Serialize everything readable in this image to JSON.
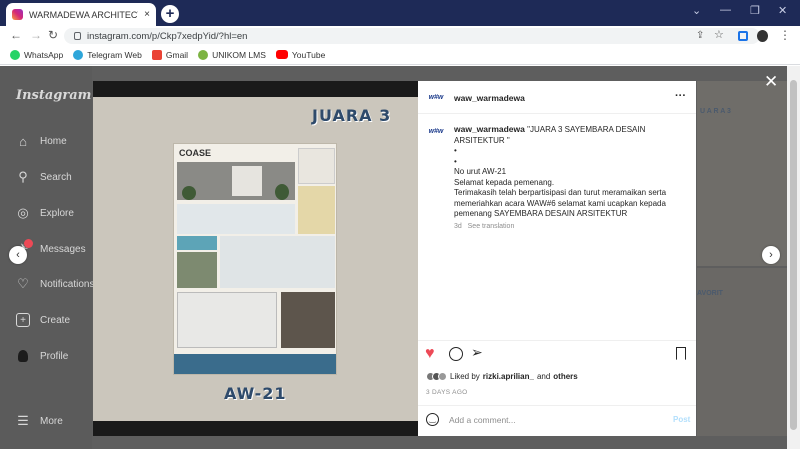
{
  "tab": {
    "title": "WARMADEWA ARCHITECTURE (@",
    "close": "×",
    "newtab": "+"
  },
  "window": {
    "min": "—",
    "restore": "❐",
    "close": "✕",
    "chevron": "⌄"
  },
  "address": {
    "url": "instagram.com/p/Ckp7xedpYid/?hl=en"
  },
  "bookmarks": [
    {
      "label": "WhatsApp",
      "color": "#25d366"
    },
    {
      "label": "Telegram Web",
      "color": "#2ea6da"
    },
    {
      "label": "Gmail",
      "color": "#ea4335"
    },
    {
      "label": "UNIKOM LMS",
      "color": "#7cb342"
    },
    {
      "label": "YouTube",
      "color": "#ff0000"
    }
  ],
  "sidebar": {
    "logo": "Instagram",
    "items": [
      {
        "label": "Home",
        "icon": "home-icon"
      },
      {
        "label": "Search",
        "icon": "search-icon"
      },
      {
        "label": "Explore",
        "icon": "explore-icon"
      },
      {
        "label": "Messages",
        "icon": "messages-icon"
      },
      {
        "label": "Notifications",
        "icon": "heart-icon"
      },
      {
        "label": "Create",
        "icon": "plus-icon"
      },
      {
        "label": "Profile",
        "icon": "profile-icon"
      }
    ],
    "more": "More"
  },
  "post": {
    "banner_top": "JUARA 3",
    "banner_bottom": "AW-21",
    "poster_title": "COASE",
    "username": "waw_warmadewa",
    "avatar_text": "w#w",
    "more": "···",
    "caption_lead": "\"JUARA 3 SAYEMBARA DESAIN ARSITEKTUR \"",
    "caption_lines": [
      "•",
      "•",
      "No urut AW-21",
      "Selamat kepada pemenang.",
      "Terimakasih telah berpartisipasi dan turut meramaikan serta memeriahkan acara WAW#6 selamat kami ucapkan kepada pemenang SAYEMBARA DESAIN ARSITEKTUR"
    ],
    "age": "3d",
    "see_translation": "See translation",
    "liked_by_prefix": "Liked by",
    "liked_user": "rizki.aprilian_",
    "liked_and": "and",
    "liked_others": "others",
    "time": "3 DAYS AGO",
    "comment_placeholder": "Add a comment...",
    "post_button": "Post",
    "like_color": "#ed4956",
    "bg_text": [
      "U A R A 3",
      "AVORIT"
    ]
  }
}
